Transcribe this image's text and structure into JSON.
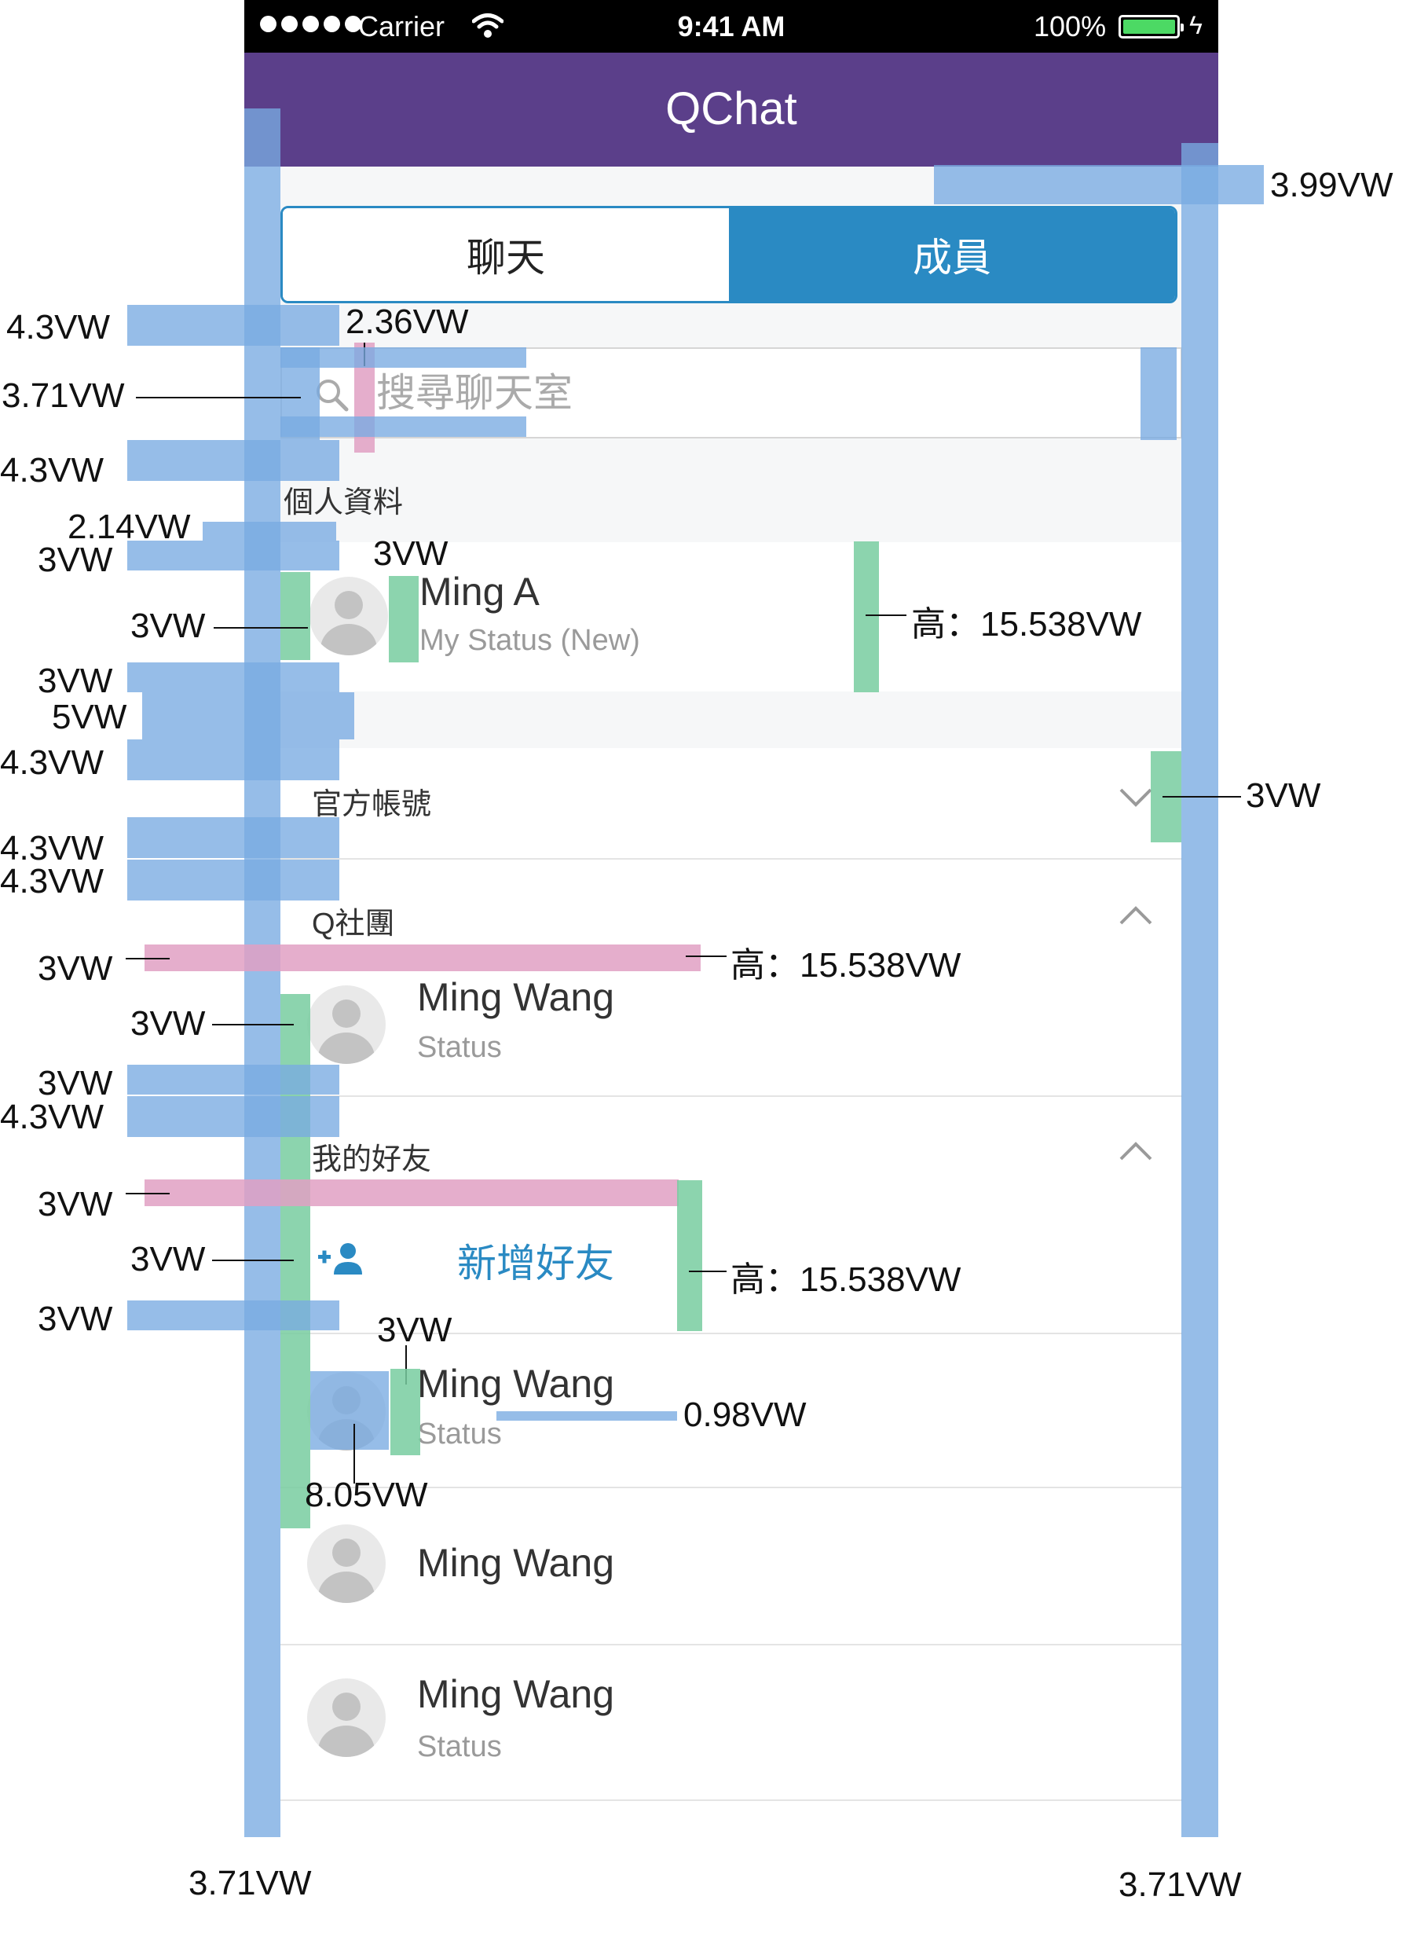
{
  "statusbar": {
    "carrier": "Carrier",
    "time": "9:41 AM",
    "battery": "100%"
  },
  "app": {
    "title": "QChat"
  },
  "tabs": [
    {
      "label": "聊天",
      "active": false
    },
    {
      "label": "成員",
      "active": true
    }
  ],
  "search": {
    "placeholder": "搜尋聊天室"
  },
  "profile": {
    "section_title": "個人資料",
    "name": "Ming A",
    "status": "My Status (New)"
  },
  "official": {
    "section_title": "官方帳號",
    "expanded": false
  },
  "groups": {
    "section_title": "Q社團",
    "expanded": true,
    "members": [
      {
        "name": "Ming Wang",
        "status": "Status"
      }
    ]
  },
  "friends": {
    "section_title": "我的好友",
    "expanded": true,
    "add_label": "新增好友",
    "members": [
      {
        "name": "Ming Wang",
        "status": "Status"
      },
      {
        "name": "Ming Wang",
        "status": ""
      },
      {
        "name": "Ming Wang",
        "status": "Status"
      }
    ]
  },
  "colors": {
    "nav_purple": "#5b3f8a",
    "accent_blue": "#2a8ac3",
    "status_green": "#4cd964"
  },
  "annotations": {
    "right_top_padding": "3.99VW",
    "search_top_gap": "4.3VW",
    "search_icon_gap": "2.36VW",
    "search_left_padding": "3.71VW",
    "search_bottom_gap": "4.3VW",
    "section_title_gap": "2.14VW",
    "profile_top": "3VW",
    "profile_avatar_right": "3VW",
    "profile_avatar_left": "3VW",
    "profile_height": "高：15.538VW",
    "profile_bottom": "3VW",
    "section_spacer": "5VW",
    "official_top": "4.3VW",
    "chevron_right": "3VW",
    "official_bottom": "4.3VW",
    "group_top": "4.3VW",
    "group_row_top": "3VW",
    "group_row_height": "高：15.538VW",
    "group_avatar_left": "3VW",
    "group_bottom": "3VW",
    "friends_top": "4.3VW",
    "friends_row_top": "3VW",
    "add_row_height": "高：15.538VW",
    "add_icon_left": "3VW",
    "add_bottom": "3VW",
    "name_gap": "3VW",
    "line_width": "0.98VW",
    "avatar_size": "8.05VW",
    "page_left": "3.71VW",
    "page_right": "3.71VW"
  }
}
